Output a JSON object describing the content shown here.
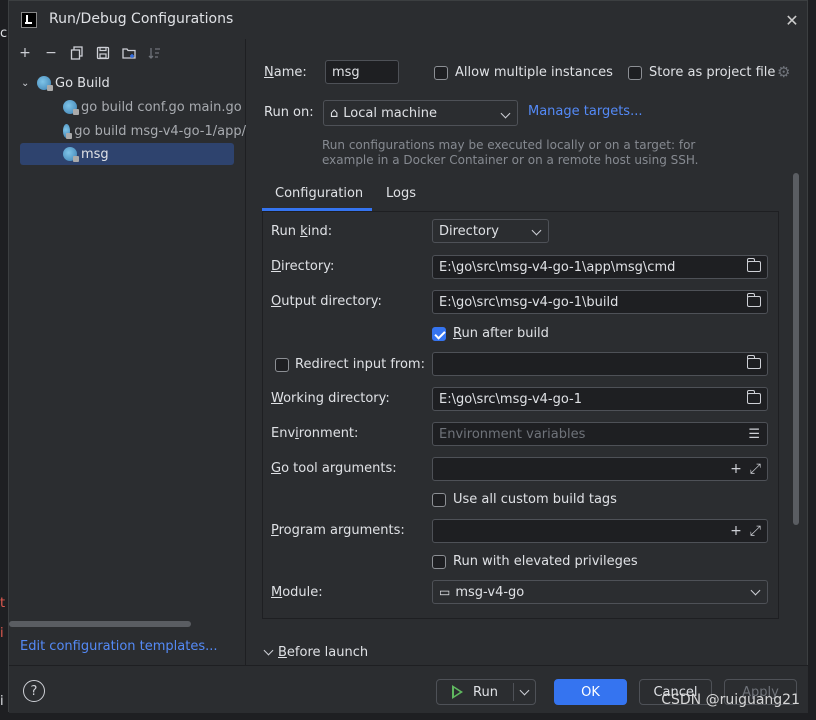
{
  "window": {
    "title": "Run/Debug Configurations"
  },
  "tree": {
    "group": "Go Build",
    "items": [
      {
        "label": "go build conf.go main.go"
      },
      {
        "label": "go build msg-v4-go-1/app/"
      },
      {
        "label": "msg"
      }
    ],
    "edit_templates": "Edit configuration templates..."
  },
  "form": {
    "name_label": "Name:",
    "name_value": "msg",
    "allow_multiple": "Allow multiple instances",
    "store_project": "Store as project file",
    "run_on_label": "Run on:",
    "run_on_value": "Local machine",
    "manage_targets": "Manage targets...",
    "hint_line1": "Run configurations may be executed locally or on a target: for",
    "hint_line2": "example in a Docker Container or on a remote host using SSH."
  },
  "tabs": [
    {
      "label": "Configuration"
    },
    {
      "label": "Logs"
    }
  ],
  "config": {
    "run_kind_label": "Run kind:",
    "run_kind_value": "Directory",
    "directory_label": "Directory:",
    "directory_value": "E:\\go\\src\\msg-v4-go-1\\app\\msg\\cmd",
    "output_label": "Output directory:",
    "output_value": "E:\\go\\src\\msg-v4-go-1\\build",
    "run_after_build": "Run after build",
    "redirect_label": "Redirect input from:",
    "working_label": "Working directory:",
    "working_value": "E:\\go\\src\\msg-v4-go-1",
    "environment_label": "Environment:",
    "environment_placeholder": "Environment variables",
    "go_tool_label": "Go tool arguments:",
    "custom_build_tags": "Use all custom build tags",
    "program_args_label": "Program arguments:",
    "elevated": "Run with elevated privileges",
    "module_label": "Module:",
    "module_value": "msg-v4-go"
  },
  "before_launch": "Before launch",
  "buttons": {
    "help": "?",
    "run": "Run",
    "ok": "OK",
    "cancel": "Cancel",
    "apply": "Apply"
  },
  "watermark": "CSDN @ruiguang21",
  "colors": {
    "accent": "#3574f0",
    "link": "#548af7",
    "selection": "#2e436e"
  }
}
